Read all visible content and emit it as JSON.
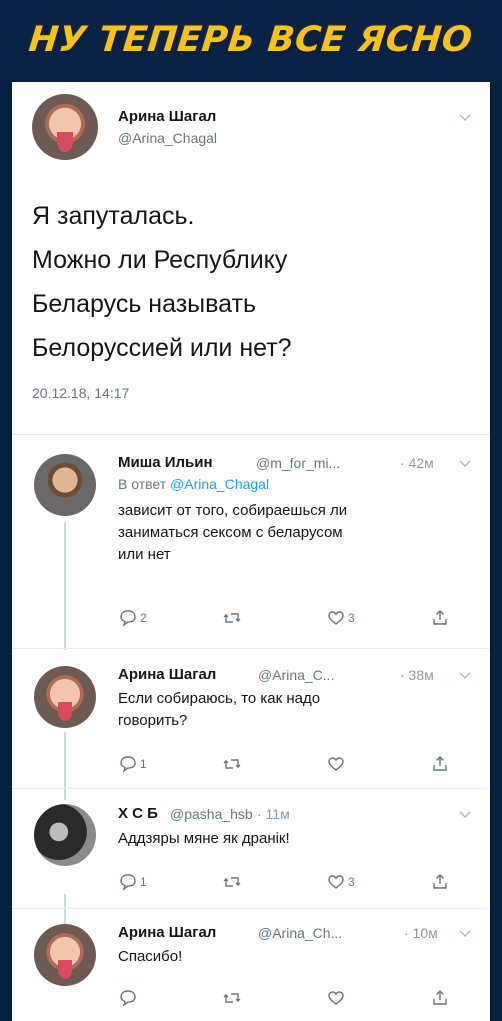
{
  "banner": {
    "title": "НУ ТЕПЕРЬ ВСЕ ЯСНО"
  },
  "main_tweet": {
    "name": "Арина Шагал",
    "handle": "@Arina_Chagal",
    "lines": [
      "Я запуталась.",
      "Можно ли Республику",
      "Беларусь называть",
      "Белоруссией или нет?"
    ],
    "timestamp": "20.12.18, 14:17"
  },
  "replies": [
    {
      "name": "Миша Ильин",
      "handle": "@m_for_mi...",
      "time": "· 42м",
      "reply_to_prefix": "В ответ",
      "reply_to_mention": "@Arina_Chagal",
      "lines": [
        "зависит от того, собираешься ли",
        "заниматься сексом с беларусом",
        "или нет"
      ],
      "comments": "2",
      "retweets": "",
      "likes": "3"
    },
    {
      "name": "Арина Шагал",
      "handle": "@Arina_C...",
      "time": "· 38м",
      "lines": [
        "Если собираюсь, то как надо",
        "говорить?"
      ],
      "comments": "1",
      "retweets": "",
      "likes": ""
    },
    {
      "name": "Х С Б",
      "handle": "@pasha_hsb",
      "time": "· 11м",
      "lines": [
        "Аддзяры мяне як дранік!"
      ],
      "comments": "1",
      "retweets": "",
      "likes": "3"
    },
    {
      "name": "Арина Шагал",
      "handle": "@Arina_Ch...",
      "time": "· 10м",
      "lines": [
        "Спасибо!"
      ],
      "comments": "",
      "retweets": "",
      "likes": ""
    }
  ],
  "colors": {
    "banner_text": "#f6c417",
    "background": "#06203f",
    "link": "#1da1f2",
    "muted": "#657786"
  },
  "icons": [
    "chevron-down-icon",
    "comment-icon",
    "retweet-icon",
    "like-icon",
    "share-icon"
  ]
}
